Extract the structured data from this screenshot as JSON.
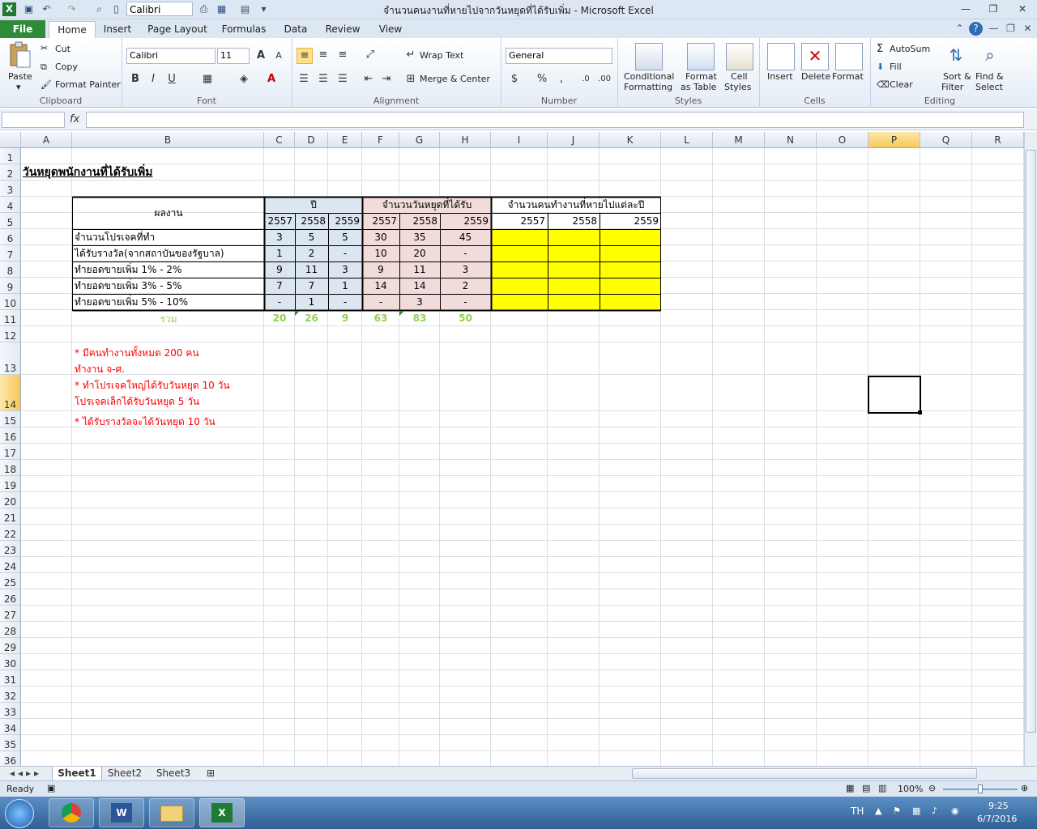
{
  "window": {
    "title": "จำนวนคนงานที่หายไปจากวันหยุดที่ได้รับเพิ่ม  -  Microsoft Excel",
    "quick_font": "Calibri"
  },
  "tabs": [
    "File",
    "Home",
    "Insert",
    "Page Layout",
    "Formulas",
    "Data",
    "Review",
    "View"
  ],
  "ribbon": {
    "clipboard": {
      "paste": "Paste",
      "cut": "Cut",
      "copy": "Copy",
      "format_painter": "Format Painter",
      "label": "Clipboard"
    },
    "font": {
      "name": "Calibri",
      "size": "11",
      "label": "Font"
    },
    "alignment": {
      "wrap": "Wrap Text",
      "merge": "Merge & Center",
      "label": "Alignment"
    },
    "number": {
      "format": "General",
      "label": "Number"
    },
    "styles": {
      "conditional": "Conditional",
      "conditional2": "Formatting",
      "format_table": "Format",
      "format_table2": "as Table",
      "cell_styles": "Cell",
      "cell_styles2": "Styles",
      "label": "Styles"
    },
    "cells": {
      "insert": "Insert",
      "delete": "Delete",
      "format": "Format",
      "label": "Cells"
    },
    "editing": {
      "autosum": "AutoSum",
      "fill": "Fill",
      "clear": "Clear",
      "sort": "Sort &",
      "sort2": "Filter",
      "find": "Find &",
      "find2": "Select",
      "label": "Editing"
    }
  },
  "formula_bar": {
    "fx": "fx",
    "value": ""
  },
  "columns": [
    "A",
    "B",
    "C",
    "D",
    "E",
    "F",
    "G",
    "H",
    "I",
    "J",
    "K",
    "L",
    "M",
    "N",
    "O",
    "P",
    "Q",
    "R"
  ],
  "rows": [
    "1",
    "2",
    "3",
    "4",
    "5",
    "6",
    "7",
    "8",
    "9",
    "10",
    "11",
    "12",
    "13",
    "14",
    "15",
    "16",
    "17",
    "18",
    "19",
    "20",
    "21",
    "22",
    "23",
    "24",
    "25",
    "26",
    "27",
    "28",
    "29",
    "30",
    "31",
    "32",
    "33",
    "34",
    "35",
    "36"
  ],
  "sheet": {
    "title": "วันหยุดพนักงานที่ได้รับเพิ่ม",
    "header_work": "ผลงาน",
    "header_year": "ปี",
    "header_days": "จำนวนวันหยุดที่ได้รับ",
    "header_people": "จำนวนคนทำงานที่หายไปแต่ละปี",
    "years": [
      "2557",
      "2558",
      "2559",
      "2557",
      "2558",
      "2559",
      "2557",
      "2558",
      "2559"
    ],
    "table_rows": [
      {
        "label": "จำนวนโปรเจคที่ทำ",
        "c": "3",
        "d": "5",
        "e": "5",
        "f": "30",
        "g": "35",
        "h": "45"
      },
      {
        "label": "ได้รับรางวัล(จากสถาบันของรัฐบาล)",
        "c": "1",
        "d": "2",
        "e": "-",
        "f": "10",
        "g": "20",
        "h": "-"
      },
      {
        "label": "ทำยอดขายเพิ่ม   1% - 2%",
        "c": "9",
        "d": "11",
        "e": "3",
        "f": "9",
        "g": "11",
        "h": "3"
      },
      {
        "label": "ทำยอดขายเพิ่ม   3% - 5%",
        "c": "7",
        "d": "7",
        "e": "1",
        "f": "14",
        "g": "14",
        "h": "2"
      },
      {
        "label": "ทำยอดขายเพิ่ม   5% - 10%",
        "c": "-",
        "d": "1",
        "e": "-",
        "f": "-",
        "g": "3",
        "h": "-"
      }
    ],
    "total_label": "รวม",
    "totals": [
      "20",
      "26",
      "9",
      "63",
      "83",
      "50"
    ],
    "notes": [
      "* มีคนทำงานทั้งหมด   200 คน",
      "   ทำงาน   จ-ศ.",
      "* ทำโปรเจคใหญ่ได้รับวันหยุด   10 วัน",
      "   โปรเจคเล็กได้รับวันหยุด   5 วัน",
      "* ได้รับรางวัลจะได้วันหยุด   10 วัน"
    ]
  },
  "sheet_tabs": [
    "Sheet1",
    "Sheet2",
    "Sheet3"
  ],
  "status": {
    "ready": "Ready",
    "zoom": "100%"
  },
  "taskbar": {
    "lang": "TH",
    "time": "9:25",
    "date": "6/7/2016"
  },
  "colors": {
    "header_blue": "#dce6f1",
    "header_pink": "#f2dcdb",
    "yellow": "#ffff00",
    "note_red": "#ff0000",
    "total_green": "#92d050"
  }
}
